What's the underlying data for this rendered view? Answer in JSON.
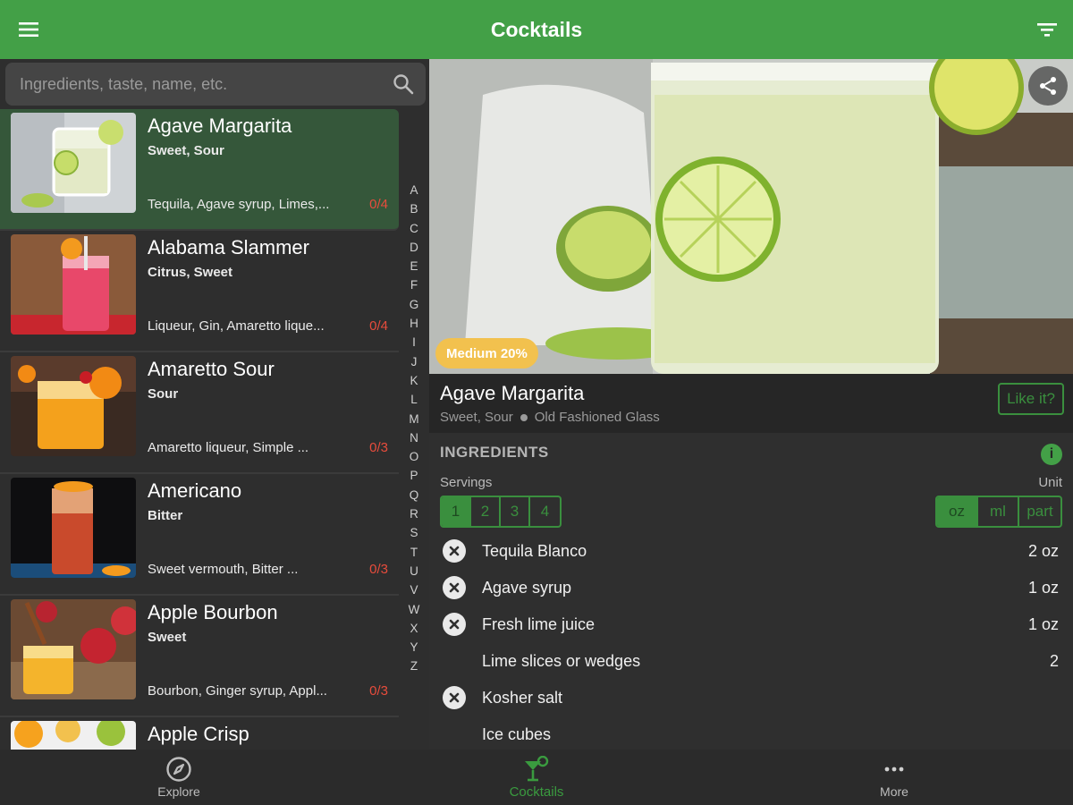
{
  "appbar": {
    "title": "Cocktails",
    "menu_icon": "menu-icon",
    "filter_icon": "filter-icon"
  },
  "search": {
    "placeholder": "Ingredients, taste, name, etc.",
    "value": ""
  },
  "list": [
    {
      "name": "Agave Margarita",
      "taste": "Sweet, Sour",
      "ingredients": "Tequila, Agave syrup, Limes,...",
      "count": "0/4",
      "selected": true
    },
    {
      "name": "Alabama Slammer",
      "taste": "Citrus, Sweet",
      "ingredients": "Liqueur, Gin, Amaretto lique...",
      "count": "0/4",
      "selected": false
    },
    {
      "name": "Amaretto Sour",
      "taste": "Sour",
      "ingredients": "Amaretto liqueur, Simple ...",
      "count": "0/3",
      "selected": false
    },
    {
      "name": "Americano",
      "taste": "Bitter",
      "ingredients": "Sweet vermouth, Bitter ...",
      "count": "0/3",
      "selected": false
    },
    {
      "name": "Apple Bourbon",
      "taste": "Sweet",
      "ingredients": "Bourbon, Ginger syrup, Appl...",
      "count": "0/3",
      "selected": false
    },
    {
      "name": "Apple Crisp",
      "taste": "",
      "ingredients": "",
      "count": "",
      "selected": false
    }
  ],
  "alphabet": [
    "A",
    "B",
    "C",
    "D",
    "E",
    "F",
    "G",
    "H",
    "I",
    "J",
    "K",
    "L",
    "M",
    "N",
    "O",
    "P",
    "Q",
    "R",
    "S",
    "T",
    "U",
    "V",
    "W",
    "X",
    "Y",
    "Z"
  ],
  "detail": {
    "strength_badge": "Medium 20%",
    "name": "Agave Margarita",
    "taste": "Sweet, Sour",
    "glass": "Old Fashioned Glass",
    "like_label": "Like it?",
    "ingredients_title": "INGREDIENTS",
    "info_label": "i",
    "servings_label": "Servings",
    "unit_label": "Unit",
    "servings": [
      "1",
      "2",
      "3",
      "4"
    ],
    "servings_selected": "1",
    "units": [
      "oz",
      "ml",
      "part"
    ],
    "unit_selected": "oz",
    "ingredients": [
      {
        "name": "Tequila Blanco",
        "amount": "2 oz",
        "missing": true
      },
      {
        "name": "Agave syrup",
        "amount": "1 oz",
        "missing": true
      },
      {
        "name": "Fresh lime juice",
        "amount": "1 oz",
        "missing": true
      },
      {
        "name": "Lime slices or wedges",
        "amount": "2",
        "missing": false
      },
      {
        "name": "Kosher salt",
        "amount": "",
        "missing": true
      },
      {
        "name": "Ice cubes",
        "amount": "",
        "missing": false
      }
    ]
  },
  "bottom_nav": [
    {
      "label": "Explore",
      "icon": "compass-icon",
      "active": false
    },
    {
      "label": "Cocktails",
      "icon": "cocktail-icon",
      "active": true
    },
    {
      "label": "More",
      "icon": "more-dots-icon",
      "active": false
    }
  ],
  "colors": {
    "accent": "#43a047",
    "badge": "#f2c14e",
    "count_red": "#e74c3c"
  }
}
